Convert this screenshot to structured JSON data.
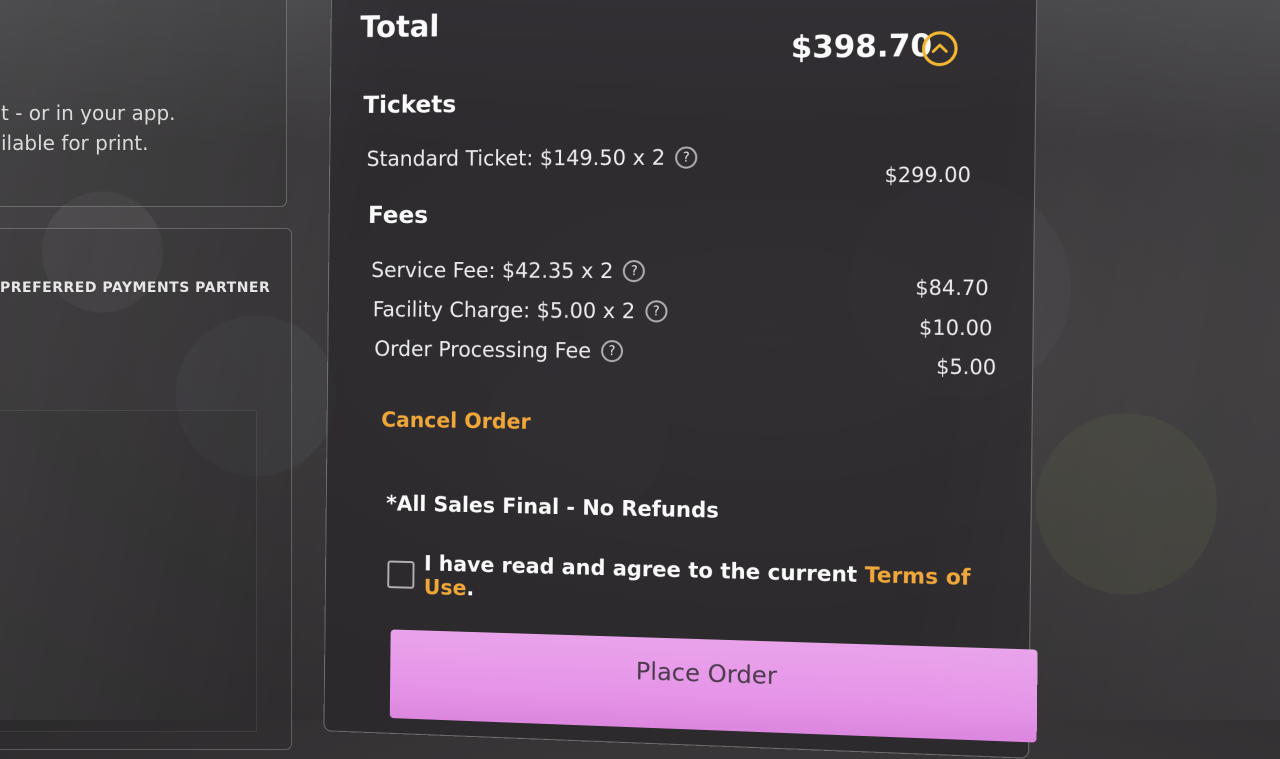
{
  "left_panel": {
    "line1": "t - or in your app.",
    "line2": "ilable for print.",
    "partner_label": "PREFERRED PAYMENTS PARTNER"
  },
  "summary": {
    "total_label": "Total",
    "total_amount": "$398.70",
    "collapse_icon": "chevron-up-icon",
    "tickets_heading": "Tickets",
    "tickets": [
      {
        "label": "Standard Ticket: $149.50 x 2",
        "amount": "$299.00"
      }
    ],
    "fees_heading": "Fees",
    "fees": [
      {
        "label": "Service Fee: $42.35 x 2",
        "amount": "$84.70"
      },
      {
        "label": "Facility Charge: $5.00 x 2",
        "amount": "$10.00"
      },
      {
        "label": "Order Processing Fee",
        "amount": "$5.00"
      }
    ],
    "help_glyph": "?",
    "cancel_label": "Cancel Order",
    "sales_final": "*All Sales Final - No Refunds",
    "agree_text": "I have read and agree to the current",
    "terms_link": "Terms of Use",
    "agree_suffix": ".",
    "agree_checked": false,
    "place_order_label": "Place Order"
  },
  "colors": {
    "accent_orange": "#f0a73a",
    "chevron_yellow": "#f5b731",
    "button_pink": "#e695e8"
  }
}
